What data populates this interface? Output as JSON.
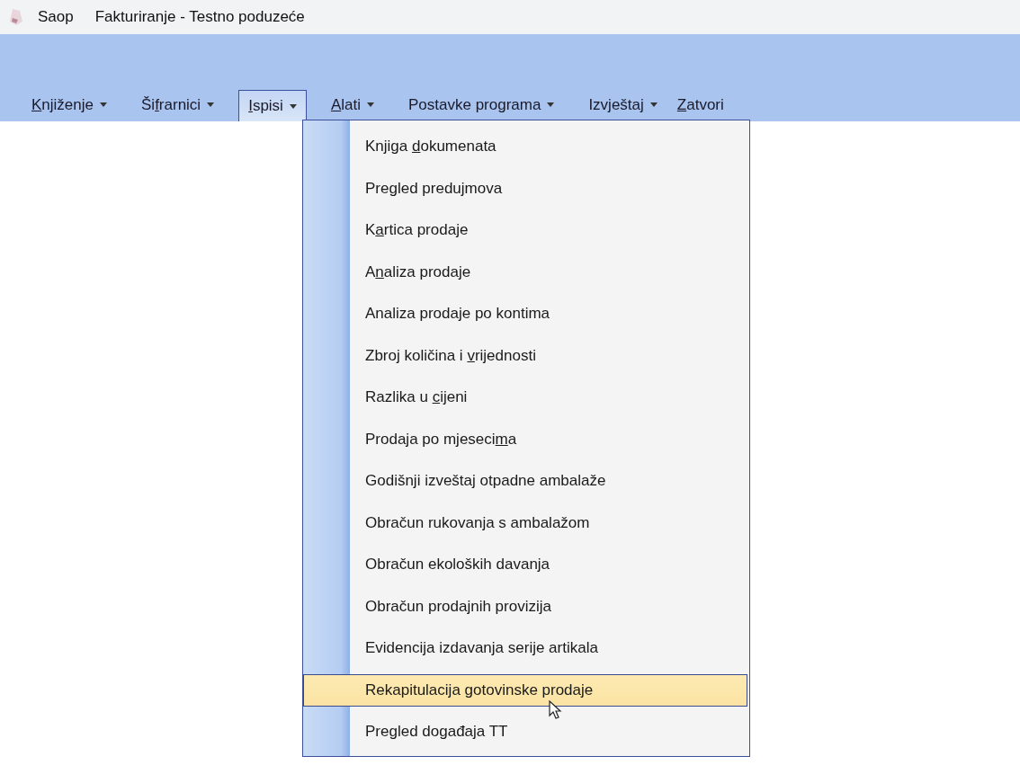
{
  "window": {
    "title_app": "Saop",
    "title": "Fakturiranje - Testno poduzeće"
  },
  "menu_bar": [
    {
      "key": "K",
      "post": "njiženje",
      "dropdown": true,
      "selected": false
    },
    {
      "pre": "Ši",
      "key": "f",
      "post": "rarnici",
      "dropdown": true,
      "selected": false
    },
    {
      "key": "I",
      "post": "spisi",
      "dropdown": true,
      "selected": true
    },
    {
      "key": "A",
      "post": "lati",
      "dropdown": true,
      "selected": false
    },
    {
      "pre": "Postavke programa",
      "dropdown": true,
      "selected": false
    },
    {
      "pre": "Izvještaj",
      "dropdown": true,
      "selected": false
    },
    {
      "key": "Z",
      "post": "atvori",
      "dropdown": false,
      "selected": false
    }
  ],
  "menu_items": [
    {
      "pre": "Knjiga ",
      "key": "d",
      "post": "okumenata",
      "selected": false
    },
    {
      "pre": "Pregled predujmova",
      "selected": false
    },
    {
      "pre": "K",
      "key": "a",
      "post": "rtica prodaje",
      "selected": false
    },
    {
      "pre": "A",
      "key": "n",
      "post": "aliza prodaje",
      "selected": false
    },
    {
      "pre": "Analiza prodaje po kontima",
      "selected": false
    },
    {
      "pre": "Zbroj količina i ",
      "key": "v",
      "post": "rijednosti",
      "selected": false
    },
    {
      "pre": "Razlika u ",
      "key": "c",
      "post": "ijeni",
      "selected": false
    },
    {
      "pre": "Prodaja po mjeseci",
      "key": "m",
      "post": "a",
      "selected": false
    },
    {
      "pre": "Godišnji izveštaj otpadne ambalaže",
      "selected": false
    },
    {
      "pre": "Obračun rukovanja s ambalažom",
      "selected": false
    },
    {
      "pre": "Obračun ekoloških davanja",
      "selected": false
    },
    {
      "pre": "Obračun prodajnih provizija",
      "selected": false
    },
    {
      "pre": "Evidencija izdavanja serije artikala",
      "selected": false
    },
    {
      "pre": "Rekapitulacija gotovinske prodaje",
      "selected": true
    },
    {
      "pre": "Pregled događaja TT",
      "selected": false
    }
  ]
}
